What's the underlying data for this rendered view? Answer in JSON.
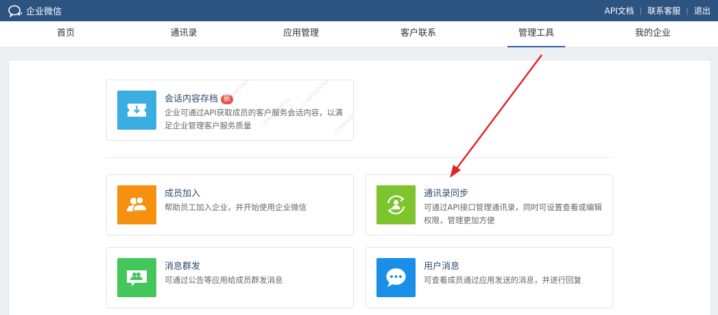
{
  "topbar": {
    "logo_text": "企业微信",
    "links": {
      "api_docs": "API文档",
      "support": "联系客服",
      "logout": "退出"
    }
  },
  "nav": {
    "home": "首页",
    "contacts": "通讯录",
    "apps": "应用管理",
    "customers": "客户联系",
    "tools": "管理工具",
    "company": "我的企业",
    "active": "管理工具"
  },
  "cards": {
    "archive": {
      "title": "会话内容存档",
      "badge": "新",
      "desc": "企业可通过API获取成员的客户服务会话内容，以满足企业管理客户服务质量",
      "color": "#3aaee0"
    },
    "join": {
      "title": "成员加入",
      "desc": "帮助员工加入企业，并开始使用企业微信",
      "color": "#f6900e"
    },
    "sync": {
      "title": "通讯录同步",
      "desc": "可通过API接口管理通讯录，同时可设置查看或编辑权限，管理更加方便",
      "color": "#7ec42e"
    },
    "broadcast": {
      "title": "消息群发",
      "desc": "可通过公告等应用给成员群发消息",
      "color": "#45c65b"
    },
    "user_msg": {
      "title": "用户消息",
      "desc": "可查看成员通过应用发送的消息，并进行回复",
      "color": "#1a8fe8"
    }
  },
  "annotation": {
    "arrow_color": "#e0242a"
  }
}
